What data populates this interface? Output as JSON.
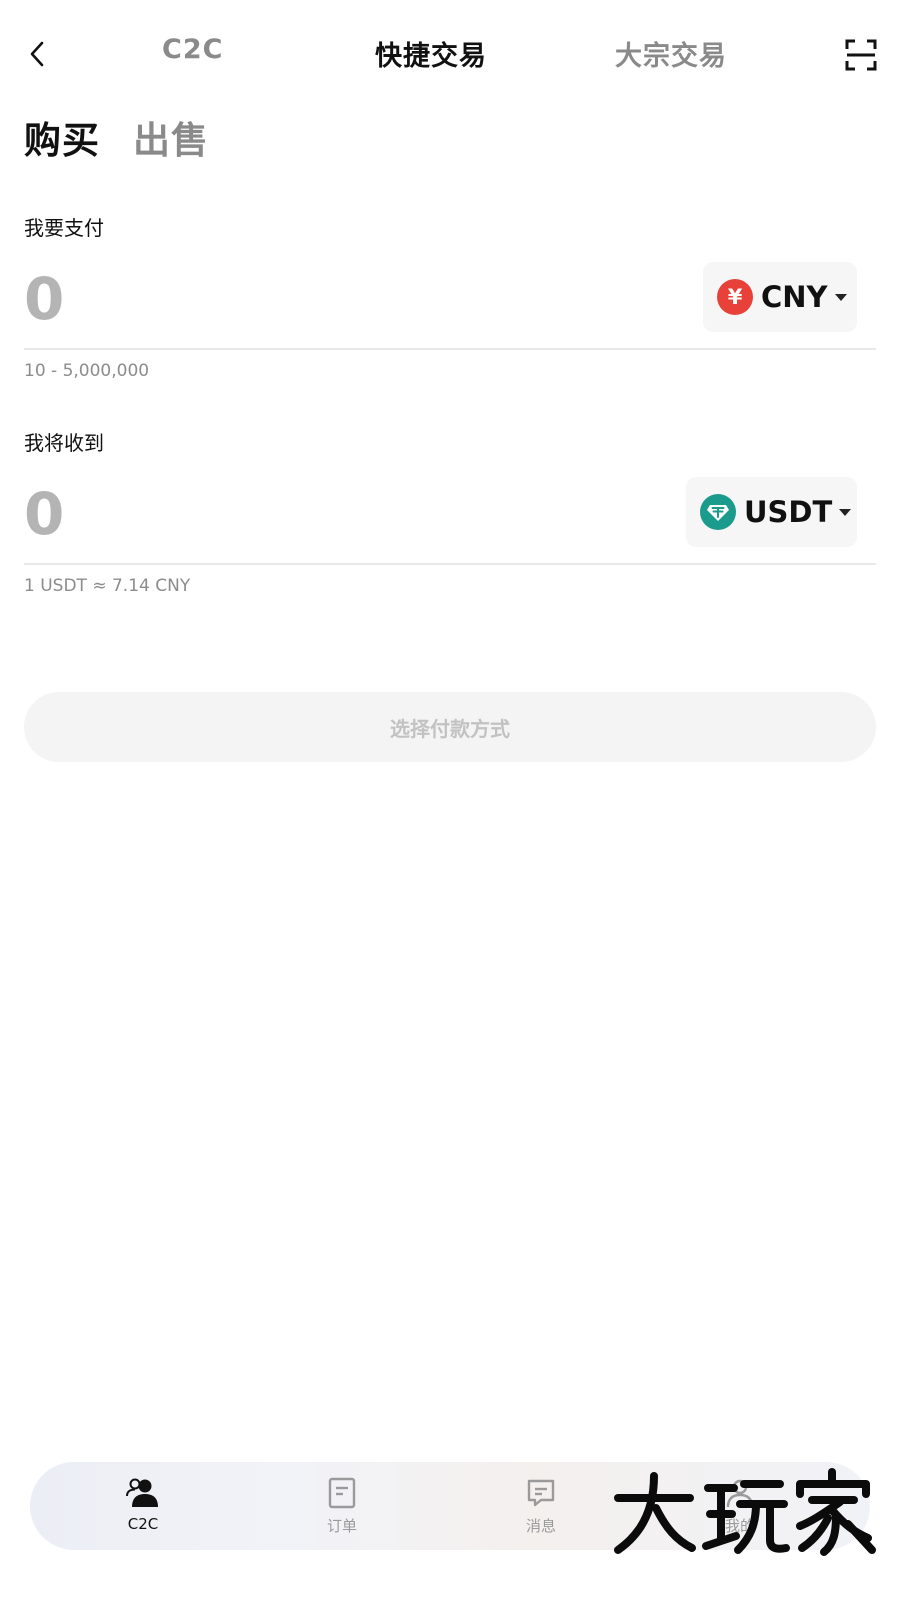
{
  "header": {
    "tabs": [
      {
        "label": "C2C",
        "active": false
      },
      {
        "label": "快捷交易",
        "active": true
      },
      {
        "label": "大宗交易",
        "active": false
      }
    ],
    "back_icon": "chevron-left-icon",
    "scan_icon": "scan-icon"
  },
  "side_tabs": [
    {
      "label": "购买",
      "active": true
    },
    {
      "label": "出售",
      "active": false
    }
  ],
  "pay": {
    "label": "我要支付",
    "placeholder": "0",
    "currency": "CNY",
    "currency_symbol": "¥",
    "currency_color": "#e8413a",
    "range_hint": "10 - 5,000,000"
  },
  "receive": {
    "label": "我将收到",
    "placeholder": "0",
    "currency": "USDT",
    "currency_symbol": "₮",
    "currency_color": "#1a9b8c",
    "rate_hint": "1 USDT ≈ 7.14 CNY"
  },
  "action": {
    "label": "选择付款方式",
    "enabled": false
  },
  "bottom_nav": [
    {
      "label": "C2C",
      "icon": "users-icon",
      "active": true
    },
    {
      "label": "订单",
      "icon": "document-icon",
      "active": false
    },
    {
      "label": "消息",
      "icon": "message-icon",
      "active": false
    },
    {
      "label": "我的",
      "icon": "profile-icon",
      "active": false
    }
  ],
  "watermark": {
    "text": "大玩家"
  }
}
